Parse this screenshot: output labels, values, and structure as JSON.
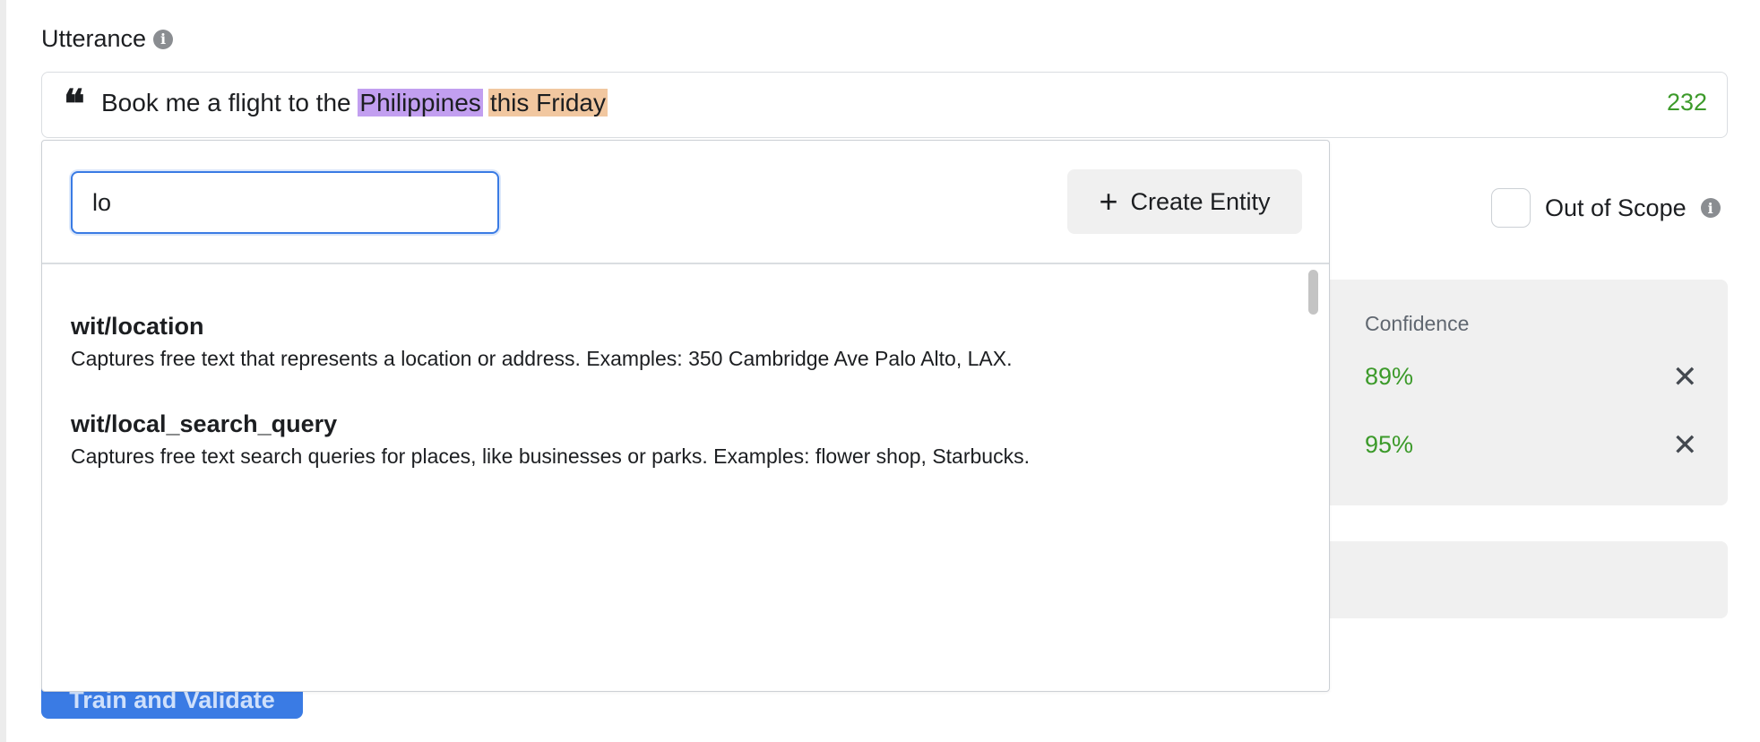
{
  "utterance": {
    "label": "Utterance",
    "text_before": "Book me a flight to the ",
    "entity_1": "Philippines",
    "entity_2": "this Friday",
    "count": "232"
  },
  "out_of_scope": {
    "label": "Out of Scope"
  },
  "confidence": {
    "header": "Confidence",
    "values": [
      "89%",
      "95%"
    ]
  },
  "train_button": {
    "label": "Train and Validate"
  },
  "entity_dropdown": {
    "search_value": "lo",
    "create_label": "Create Entity",
    "options": [
      {
        "name": "wit/location",
        "description": "Captures free text that represents a location or address. Examples: 350 Cambridge Ave Palo Alto, LAX."
      },
      {
        "name": "wit/local_search_query",
        "description": "Captures free text search queries for places, like businesses or parks. Examples: flower shop, Starbucks."
      }
    ]
  },
  "icons": {
    "info": "info-icon",
    "quote": "quote-icon",
    "plus": "plus-icon",
    "close": "close-icon"
  },
  "colors": {
    "accent": "#3a7be4",
    "success": "#3c9a2a",
    "entity_purple": "#c29ff0",
    "entity_orange": "#f1c7a0"
  }
}
